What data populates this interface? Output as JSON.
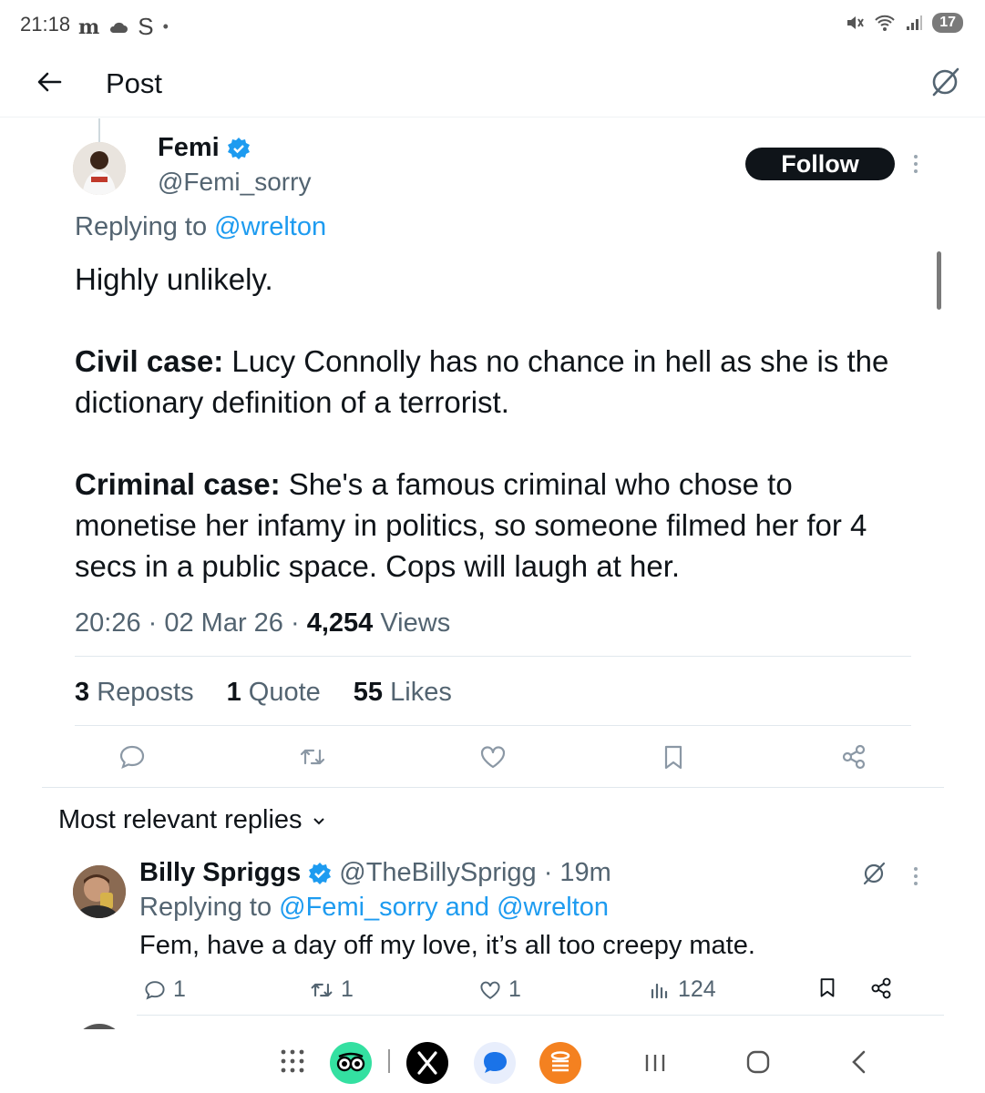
{
  "status_bar": {
    "time": "21:18",
    "icons": [
      "mail-m-icon",
      "cloud-icon",
      "s-app-icon",
      "dot-icon"
    ],
    "right_icons": [
      "mute-icon",
      "wifi-icon",
      "signal-icon"
    ],
    "battery": "17"
  },
  "header": {
    "title": "Post"
  },
  "post": {
    "author_name": "Femi",
    "author_handle": "@Femi_sorry",
    "follow_label": "Follow",
    "replying_prefix": "Replying to",
    "replying_to": "@wrelton",
    "body_line1": "Highly unlikely.",
    "civil_label": "Civil case:",
    "civil_text": " Lucy Connolly has no chance in hell as she is the dictionary definition of a terrorist.",
    "criminal_label": "Criminal case:",
    "criminal_text": " She's a famous criminal who chose to monetise her infamy in politics, so someone filmed her for 4 secs in a public space. Cops will laugh at her.",
    "time": "20:26",
    "date": "02 Mar 26",
    "views_count": "4,254",
    "views_label": "Views",
    "reposts_count": "3",
    "reposts_label": "Reposts",
    "quotes_count": "1",
    "quotes_label": "Quote",
    "likes_count": "55",
    "likes_label": "Likes"
  },
  "replies_section": {
    "label": "Most relevant replies"
  },
  "reply": {
    "author_name": "Billy Spriggs",
    "author_handle": "@TheBillySprigg",
    "age": "19m",
    "replying_prefix": "Replying to",
    "replying_to": "@Femi_sorry and @wrelton",
    "text": "Fem, have a day off my love, it’s all too creepy mate.",
    "reply_count": "1",
    "repost_count": "1",
    "like_count": "1",
    "views": "124"
  },
  "colors": {
    "accent": "#1d9bf0",
    "text": "#0f1419",
    "muted": "#536471"
  },
  "dock_apps": [
    "grid-icon",
    "tripadvisor-icon",
    "x-icon",
    "messages-icon",
    "stack-app-icon"
  ]
}
